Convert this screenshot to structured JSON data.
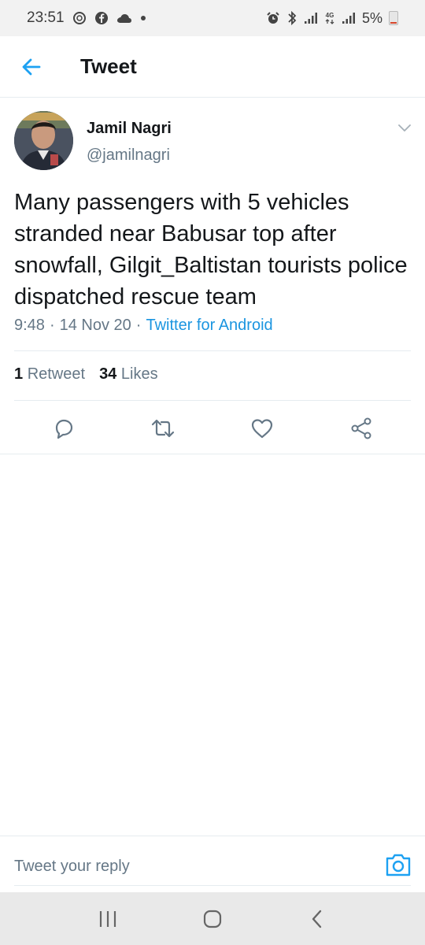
{
  "status_bar": {
    "time": "23:51",
    "battery": "5%",
    "left_icons": [
      "whatsapp-status-icon",
      "facebook-icon",
      "cloud-icon",
      "dot-icon"
    ],
    "right_icons": [
      "alarm-icon",
      "bluetooth-icon",
      "signal-icon",
      "4g-icon",
      "signal-icon",
      "battery-icon"
    ]
  },
  "header": {
    "title": "Tweet",
    "back_icon": "arrow-left-icon"
  },
  "tweet": {
    "author_name": "Jamil Nagri",
    "author_handle": "@jamilnagri",
    "text": "Many passengers with 5 vehicles stranded near Babusar top after snowfall, Gilgit_Baltistan tourists police dispatched rescue team",
    "time": "9:48",
    "separator": "·",
    "date": "14 Nov 20",
    "source": "Twitter for Android",
    "retweet_count": "1",
    "retweet_label": "Retweet",
    "like_count": "34",
    "like_label": "Likes"
  },
  "actions": [
    "reply-icon",
    "retweet-icon",
    "like-icon",
    "share-icon"
  ],
  "reply": {
    "placeholder": "Tweet your reply",
    "camera_icon": "camera-icon"
  },
  "nav": [
    "recents-icon",
    "home-icon",
    "back-icon"
  ],
  "colors": {
    "accent": "#1da1f2",
    "text_primary": "#14171a",
    "text_secondary": "#657786",
    "divider": "#e6ecf0",
    "status_bar_bg": "#f2f2f2",
    "nav_bar_bg": "#e9e9e9"
  }
}
